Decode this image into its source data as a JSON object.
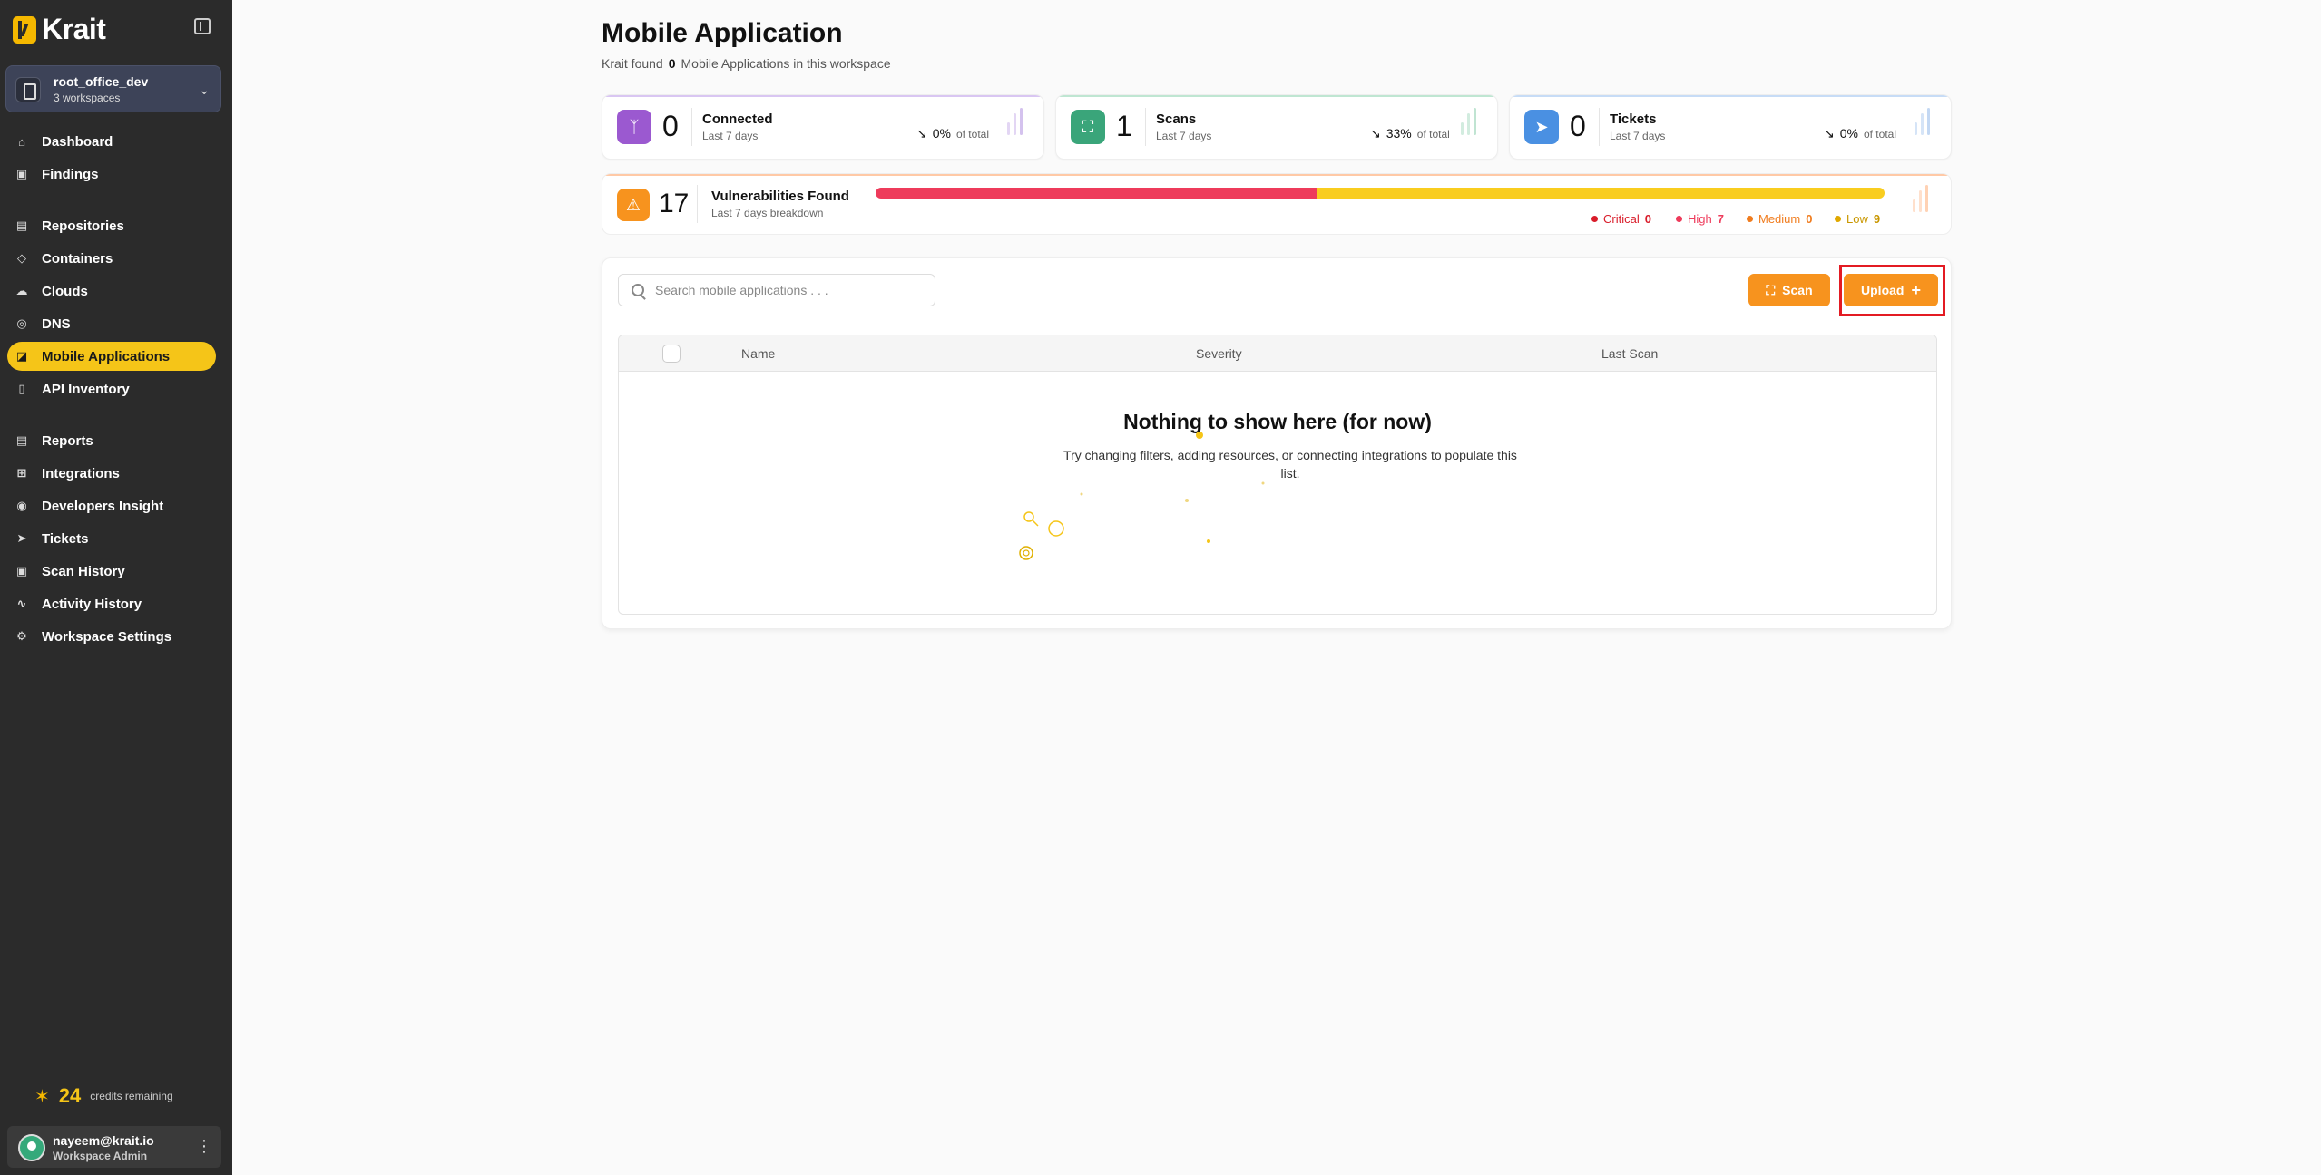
{
  "app": {
    "name": "Krait"
  },
  "workspace": {
    "name": "root_office_dev",
    "count_label": "3 workspaces"
  },
  "sidebar": {
    "items": [
      {
        "label": "Dashboard",
        "icon": "home-icon"
      },
      {
        "label": "Findings",
        "icon": "scan-icon"
      },
      {
        "label": "Repositories",
        "icon": "book-icon"
      },
      {
        "label": "Containers",
        "icon": "box-icon"
      },
      {
        "label": "Clouds",
        "icon": "cloud-icon"
      },
      {
        "label": "DNS",
        "icon": "globe-icon"
      },
      {
        "label": "Mobile Applications",
        "icon": "mobile-icon",
        "active": true
      },
      {
        "label": "API Inventory",
        "icon": "chart-icon"
      },
      {
        "label": "Reports",
        "icon": "file-icon"
      },
      {
        "label": "Integrations",
        "icon": "grid-icon"
      },
      {
        "label": "Developers Insight",
        "icon": "user-circle-icon"
      },
      {
        "label": "Tickets",
        "icon": "send-icon"
      },
      {
        "label": "Scan History",
        "icon": "scan-icon"
      },
      {
        "label": "Activity History",
        "icon": "activity-icon"
      },
      {
        "label": "Workspace Settings",
        "icon": "gear-icon"
      }
    ]
  },
  "credits": {
    "value": "24",
    "label": "credits remaining"
  },
  "user": {
    "email": "nayeem@krait.io",
    "role": "Workspace Admin"
  },
  "header": {
    "title": "Mobile Application",
    "subtitle_prefix": "Krait found",
    "count": "0",
    "subtitle_suffix": "Mobile Applications in this workspace"
  },
  "stats": [
    {
      "value": "0",
      "label": "Connected",
      "sub": "Last 7 days",
      "pct": "0%",
      "of": "of total",
      "color": "#9b59d0",
      "icon": "branch-icon"
    },
    {
      "value": "1",
      "label": "Scans",
      "sub": "Last 7 days",
      "pct": "33%",
      "of": "of total",
      "color": "#3aa57a",
      "icon": "scan-icon"
    },
    {
      "value": "0",
      "label": "Tickets",
      "sub": "Last 7 days",
      "pct": "0%",
      "of": "of total",
      "color": "#4a90e2",
      "icon": "send-icon"
    }
  ],
  "vulnerabilities": {
    "value": "17",
    "label": "Vulnerabilities Found",
    "sub": "Last 7 days breakdown",
    "breakdown": [
      {
        "label": "Critical",
        "count": "0",
        "color": "#d91c2a"
      },
      {
        "label": "High",
        "count": "7",
        "color": "#ee3b5b"
      },
      {
        "label": "Medium",
        "count": "0",
        "color": "#f07c1e"
      },
      {
        "label": "Low",
        "count": "9",
        "color": "#e0a800"
      }
    ],
    "bar_fraction_high": 0.4375,
    "bar_fraction_low": 0.5625
  },
  "toolbar": {
    "search_placeholder": "Search mobile applications . . .",
    "scan_label": "Scan",
    "upload_label": "Upload"
  },
  "table": {
    "columns": [
      "Name",
      "Severity",
      "Last Scan"
    ],
    "empty_title": "Nothing to show here (for now)",
    "empty_sub": "Try changing filters, adding resources, or connecting integrations to populate this list."
  }
}
